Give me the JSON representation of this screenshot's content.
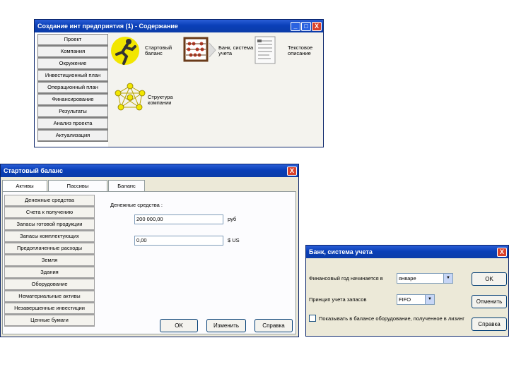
{
  "window1": {
    "title": "Создание инт предприятия (1) - Содержание",
    "nav": [
      "Проект",
      "Компания",
      "Окружение",
      "Инвестиционный план",
      "Операционный план",
      "Финансирование",
      "Результаты",
      "Анализ проекта",
      "Актуализация"
    ],
    "icons": [
      {
        "label": "Стартовый баланс",
        "icon": "running-man-icon"
      },
      {
        "label": "Банк, система учета",
        "icon": "abacus-icon"
      },
      {
        "label": "Текстовое описание",
        "icon": "document-icon"
      },
      {
        "label": "Структура компании",
        "icon": "network-icon"
      }
    ]
  },
  "window2": {
    "title": "Стартовый баланс",
    "tabs": [
      "Активы",
      "Пассивы",
      "Баланс"
    ],
    "categories": [
      "Денежные средства",
      "Счета к получению",
      "Запасы готовой продукции",
      "Запасы комплектующих",
      "Предоплаченные расходы",
      "Земля",
      "Здания",
      "Оборудование",
      "Нематериальные активы",
      "Незавершенные инвестиции",
      "Ценные бумаги"
    ],
    "field_heading": "Денежные средства :",
    "field_rub": {
      "value": "200 000,00",
      "unit": "руб"
    },
    "field_usd": {
      "value": "0,00",
      "unit": "$ US"
    },
    "buttons": {
      "ok": "OK",
      "change": "Изменить",
      "help": "Справка"
    }
  },
  "window3": {
    "title": "Банк, система учета",
    "fiscal_label": "Финансовый год начинается в",
    "fiscal_value": "январе",
    "inventory_label": "Принцип учета запасов",
    "inventory_value": "FIFO",
    "checkbox_label": "Показывать в балансе оборудование, полученное в лизинг",
    "checkbox_checked": false,
    "buttons": {
      "ok": "OK",
      "cancel": "Отменить",
      "help": "Справка"
    }
  },
  "window_controls": {
    "minimize": "_",
    "maximize": "□",
    "close": "X"
  },
  "colors": {
    "titlebar": "#0b3ca8",
    "close": "#d9412a",
    "window_bg": "#ece9d8",
    "icon_yellow": "#f2e600"
  }
}
